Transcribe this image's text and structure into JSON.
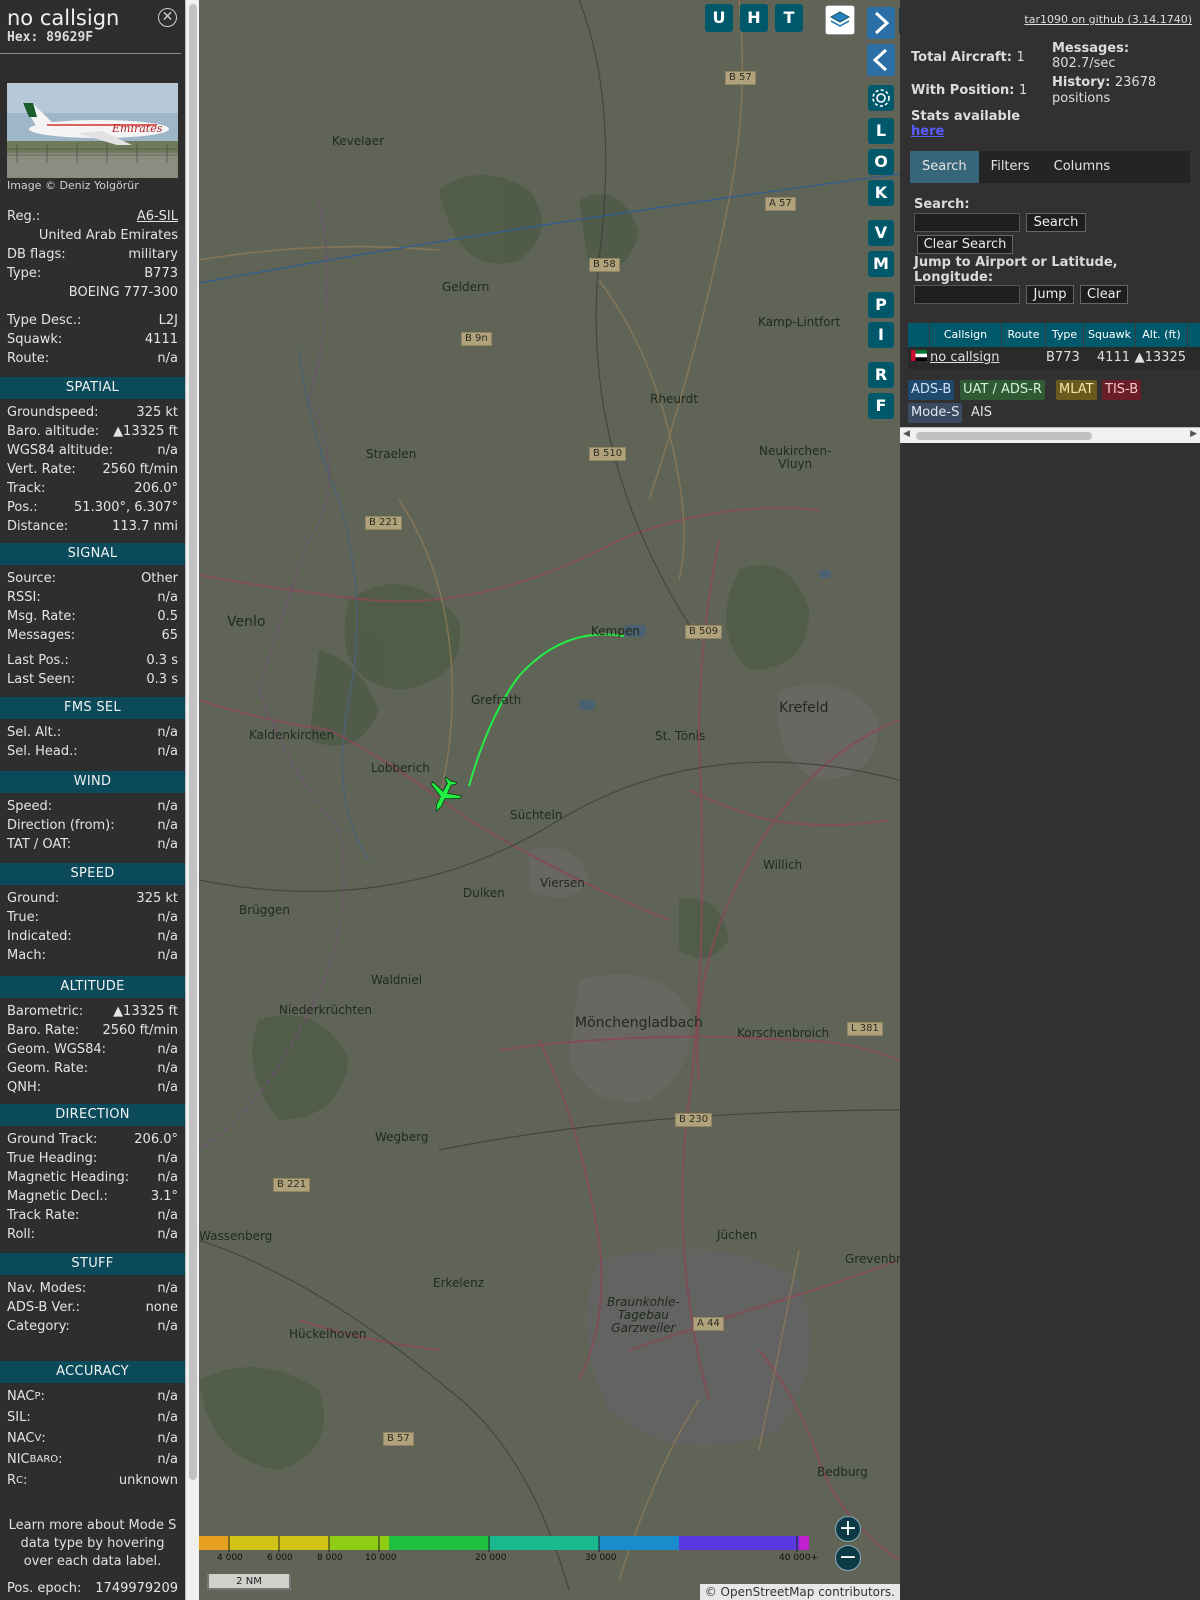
{
  "info": {
    "callsign": "no callsign",
    "hex": "Hex:  89629F",
    "photo_credit": "Image © Deniz Yolgörür",
    "reg_label": "Reg.:",
    "reg_value": "A6-SIL",
    "country": "United Arab Emirates",
    "dbflags_label": "DB flags:",
    "dbflags_value": "military",
    "type_label": "Type:",
    "type_value": "B773",
    "type_name": "BOEING 777-300",
    "typedesc_label": "Type Desc.:",
    "typedesc_value": "L2J",
    "squawk_label": "Squawk:",
    "squawk_value": "4111",
    "route_label": "Route:",
    "route_value": "n/a"
  },
  "sections": {
    "spatial": "SPATIAL",
    "signal": "SIGNAL",
    "fms": "FMS SEL",
    "wind": "WIND",
    "speed": "SPEED",
    "altitude": "ALTITUDE",
    "direction": "DIRECTION",
    "stuff": "STUFF",
    "accuracy": "ACCURACY"
  },
  "spatial": [
    {
      "label": "Groundspeed:",
      "value": "325 kt"
    },
    {
      "label": "Baro. altitude:",
      "value": "▲13325 ft"
    },
    {
      "label": "WGS84 altitude:",
      "value": "n/a"
    },
    {
      "label": "Vert. Rate:",
      "value": "2560 ft/min"
    },
    {
      "label": "Track:",
      "value": "206.0°"
    },
    {
      "label": "Pos.:",
      "value": "51.300°, 6.307°"
    },
    {
      "label": "Distance:",
      "value": "113.7 nmi"
    }
  ],
  "signal": [
    {
      "label": "Source:",
      "value": "Other"
    },
    {
      "label": "RSSI:",
      "value": "n/a"
    },
    {
      "label": "Msg. Rate:",
      "value": "0.5"
    },
    {
      "label": "Messages:",
      "value": "65"
    },
    {
      "label": "Last Pos.:",
      "value": "0.3 s"
    },
    {
      "label": "Last Seen:",
      "value": "0.3 s"
    }
  ],
  "fms": [
    {
      "label": "Sel. Alt.:",
      "value": "n/a"
    },
    {
      "label": "Sel. Head.:",
      "value": "n/a"
    }
  ],
  "wind": [
    {
      "label": "Speed:",
      "value": "n/a"
    },
    {
      "label": "Direction (from):",
      "value": "n/a"
    },
    {
      "label": "TAT / OAT:",
      "value": "n/a"
    }
  ],
  "speed": [
    {
      "label": "Ground:",
      "value": "325 kt"
    },
    {
      "label": "True:",
      "value": "n/a"
    },
    {
      "label": "Indicated:",
      "value": "n/a"
    },
    {
      "label": "Mach:",
      "value": "n/a"
    }
  ],
  "altitude": [
    {
      "label": "Barometric:",
      "value": "▲13325 ft"
    },
    {
      "label": "Baro. Rate:",
      "value": "2560 ft/min"
    },
    {
      "label": "Geom. WGS84:",
      "value": "n/a"
    },
    {
      "label": "Geom. Rate:",
      "value": "n/a"
    },
    {
      "label": "QNH:",
      "value": "n/a"
    }
  ],
  "direction": [
    {
      "label": "Ground Track:",
      "value": "206.0°"
    },
    {
      "label": "True Heading:",
      "value": "n/a"
    },
    {
      "label": "Magnetic Heading:",
      "value": "n/a"
    },
    {
      "label": "Magnetic Decl.:",
      "value": "3.1°"
    },
    {
      "label": "Track Rate:",
      "value": "n/a"
    },
    {
      "label": "Roll:",
      "value": "n/a"
    }
  ],
  "stuff": [
    {
      "label": "Nav. Modes:",
      "value": "n/a"
    },
    {
      "label": "ADS-B Ver.:",
      "value": "none"
    },
    {
      "label": "Category:",
      "value": "n/a"
    }
  ],
  "accuracy": [
    {
      "label": "NAC",
      "sub": "P",
      "value": "n/a"
    },
    {
      "label": "SIL:",
      "sub": "",
      "value": "n/a"
    },
    {
      "label": "NAC",
      "sub": "V",
      "value": "n/a"
    },
    {
      "label": "NIC",
      "sub": "BARO",
      "value": "n/a"
    },
    {
      "label": "R",
      "sub": "C",
      "value": "unknown"
    }
  ],
  "note": "Learn more about Mode S data type by hovering over each data label.",
  "epoch_label": "Pos. epoch:",
  "epoch_value": "1749979209",
  "map": {
    "buttons_top": [
      "U",
      "H",
      "T"
    ],
    "buttons_side": [
      "L",
      "O",
      "K",
      "V",
      "M",
      "P",
      "I",
      "R",
      "F"
    ],
    "zoom_in": "+",
    "zoom_out": "−",
    "scale": "2 NM",
    "attribution": "© OpenStreetMap contributors.",
    "alt_ticks": [
      "4 000",
      "6 000",
      "8 000",
      "10 000",
      "20 000",
      "30 000",
      "40 000+"
    ],
    "towns": [
      {
        "t": "Kevelaer",
        "c": ""
      },
      {
        "t": "Geldern",
        "c": ""
      },
      {
        "t": "Kamp-Lintfort",
        "c": ""
      },
      {
        "t": "Rheurdt",
        "c": ""
      },
      {
        "t": "Straelen",
        "c": ""
      },
      {
        "t": "Neukirchen-\nVluyn",
        "c": ""
      },
      {
        "t": "Venlo",
        "c": "big"
      },
      {
        "t": "Kempen",
        "c": ""
      },
      {
        "t": "Grefrath",
        "c": ""
      },
      {
        "t": "Krefeld",
        "c": "big"
      },
      {
        "t": "Kaldenkirchen",
        "c": ""
      },
      {
        "t": "Lobberich",
        "c": ""
      },
      {
        "t": "St. Tönis",
        "c": ""
      },
      {
        "t": "Süchteln",
        "c": ""
      },
      {
        "t": "Willich",
        "c": ""
      },
      {
        "t": "Viersen",
        "c": ""
      },
      {
        "t": "Dulken",
        "c": ""
      },
      {
        "t": "Brüggen",
        "c": ""
      },
      {
        "t": "Waldniel",
        "c": ""
      },
      {
        "t": "Niederkrüchten",
        "c": ""
      },
      {
        "t": "Mönchengladbach",
        "c": "big"
      },
      {
        "t": "Korschenbroich",
        "c": ""
      },
      {
        "t": "Wegberg",
        "c": ""
      },
      {
        "t": "Wassenberg",
        "c": ""
      },
      {
        "t": "Jüchen",
        "c": ""
      },
      {
        "t": "Grevenbroich",
        "c": ""
      },
      {
        "t": "Erkelenz",
        "c": ""
      },
      {
        "t": "Hückelhoven",
        "c": ""
      },
      {
        "t": "Braunkohle-\nTagebau\nGarzweiler",
        "c": ""
      },
      {
        "t": "Bedburg",
        "c": ""
      }
    ],
    "roads": [
      "B 57",
      "A 57",
      "B 58",
      "B 9n",
      "B 510",
      "B 221",
      "B 509",
      "L 381",
      "B 230",
      "B 221",
      "A 44",
      "B 57"
    ]
  },
  "right": {
    "github": "tar1090 on github (3.14.1740)",
    "total_label": "Total Aircraft:",
    "total_value": "1",
    "withpos_label": "With Position:",
    "withpos_value": "1",
    "stats_label": "Stats available",
    "stats_link": "here",
    "messages_label": "Messages:",
    "messages_value": "802.7/sec",
    "history_label": "History:",
    "history_value": "23678 positions",
    "tabs": [
      "Search",
      "Filters",
      "Columns"
    ],
    "search_label": "Search:",
    "search_button": "Search",
    "clear_search_button": "Clear Search",
    "jump_label": "Jump to Airport or Latitude, Longitude:",
    "jump_button": "Jump",
    "clear_button": "Clear",
    "table_headers": [
      "Callsign",
      "Route",
      "Type",
      "Squawk",
      "Alt. (ft)"
    ],
    "table_row": {
      "callsign": "no callsign",
      "route": "",
      "type": "B773",
      "squawk": "4111",
      "alt": "▲13325"
    },
    "sources": [
      {
        "label": "ADS-B",
        "bg": "#1f4a6e",
        "fg": "#cfe2f5"
      },
      {
        "label": "UAT / ADS-R",
        "bg": "#2e5a34",
        "fg": "#d2f0d2"
      },
      {
        "label": "MLAT",
        "bg": "#6a5a1e",
        "fg": "#f5e6a8"
      },
      {
        "label": "TIS-B",
        "bg": "#6a1f28",
        "fg": "#f5c6cb"
      },
      {
        "label": "Mode-S",
        "bg": "#3a4a60",
        "fg": "#dfe6f0"
      },
      {
        "label": "AIS",
        "bg": "transparent",
        "fg": "#e4e4e4"
      }
    ]
  }
}
